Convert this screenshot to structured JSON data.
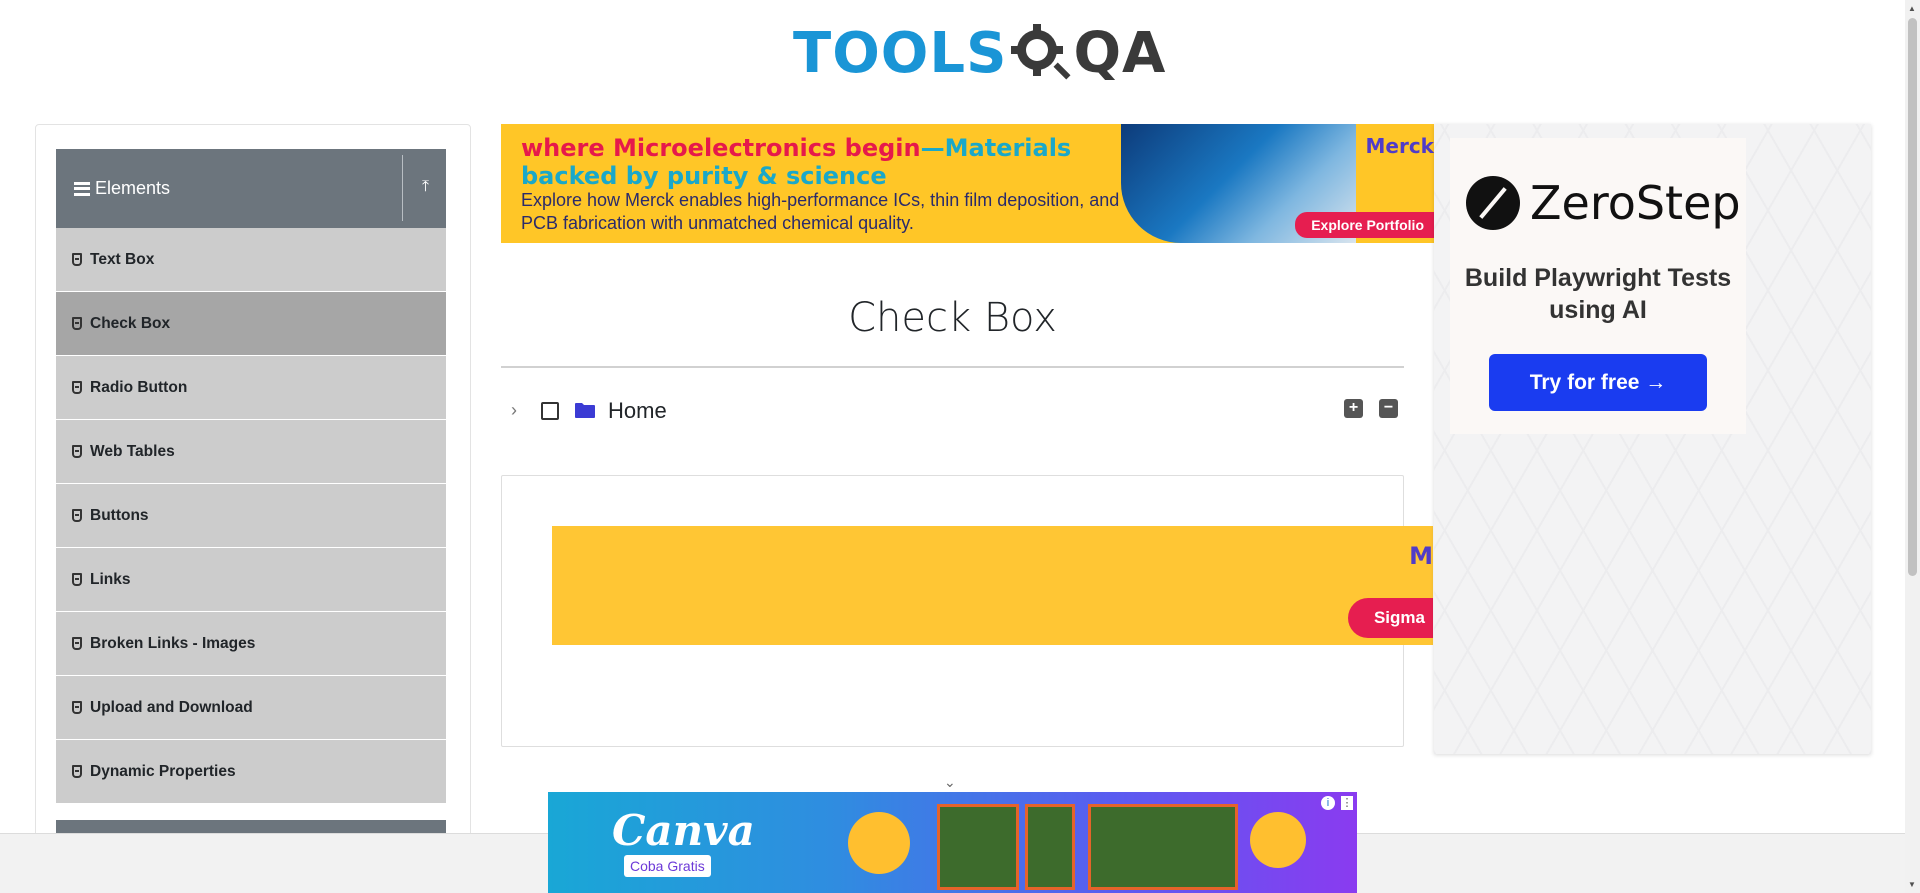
{
  "header": {
    "logo_tools": "TOOLS",
    "logo_qa": "QA"
  },
  "sidebar": {
    "group_title": "Elements",
    "items": [
      {
        "label": "Text Box"
      },
      {
        "label": "Check Box",
        "active": true
      },
      {
        "label": "Radio Button"
      },
      {
        "label": "Web Tables"
      },
      {
        "label": "Buttons"
      },
      {
        "label": "Links"
      },
      {
        "label": "Broken Links - Images"
      },
      {
        "label": "Upload and Download"
      },
      {
        "label": "Dynamic Properties"
      }
    ]
  },
  "ad_top": {
    "headline_red": "where Microelectronics begin",
    "headline_blue": "—Materials",
    "headline_line2": "backed by purity & science",
    "body": "Explore how Merck enables high-performance ICs, thin film deposition, and PCB fabrication with unmatched chemical quality.",
    "brand": "Merck",
    "cta": "Explore Portfolio"
  },
  "main": {
    "title": "Check Box",
    "tree": {
      "root_label": "Home",
      "expand_all": "+",
      "collapse_all": "−"
    }
  },
  "inner_ad": {
    "brand": "M",
    "cta": "Sigma"
  },
  "ad_right": {
    "brand": "ZeroStep",
    "tagline": "Build Playwright Tests using AI",
    "button": "Try for free →"
  },
  "ad_bottom": {
    "brand": "Canva",
    "cta": "Coba Gratis"
  },
  "colors": {
    "logo_blue": "#1a95d6",
    "sidebar_header": "#6c757d",
    "menu_bg": "#cccccc",
    "menu_active": "#a6a6a6",
    "folder_blue": "#3b3bd4",
    "zerostep_button": "#1a3cf0"
  }
}
